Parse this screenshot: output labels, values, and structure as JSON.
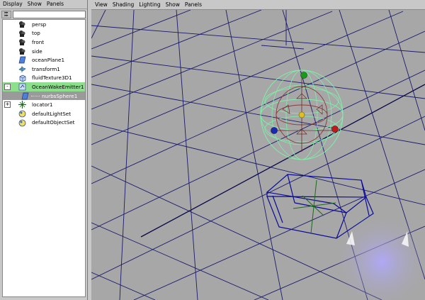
{
  "outliner": {
    "menu": [
      "Display",
      "Show",
      "Panels"
    ],
    "filter_value": "",
    "items": [
      {
        "label": "persp",
        "icon": "camera-icon"
      },
      {
        "label": "top",
        "icon": "camera-icon"
      },
      {
        "label": "front",
        "icon": "camera-icon"
      },
      {
        "label": "side",
        "icon": "camera-icon"
      },
      {
        "label": "oceanPlane1",
        "icon": "plane-icon"
      },
      {
        "label": "transform1",
        "icon": "transform-icon"
      },
      {
        "label": "fluidTexture3D1",
        "icon": "cube-icon"
      },
      {
        "label": "OceanWakeEmitter1",
        "icon": "emitter-icon",
        "selected": true,
        "expander": "-"
      },
      {
        "label": "nurbsSphere1",
        "icon": "nurbs-icon",
        "child": true
      },
      {
        "label": "locator1",
        "icon": "locator-icon",
        "expander": "+"
      },
      {
        "label": "defaultLightSet",
        "icon": "set-icon"
      },
      {
        "label": "defaultObjectSet",
        "icon": "set-icon"
      }
    ]
  },
  "viewport": {
    "menu": [
      "View",
      "Shading",
      "Lighting",
      "Show",
      "Panels"
    ]
  },
  "colors": {
    "grid": "#1a1a6e",
    "sphere": "#7ef0a8",
    "sphere_inner": "#8a3a3a",
    "box": "#0a0a9a",
    "background": "#a7a7a7"
  }
}
